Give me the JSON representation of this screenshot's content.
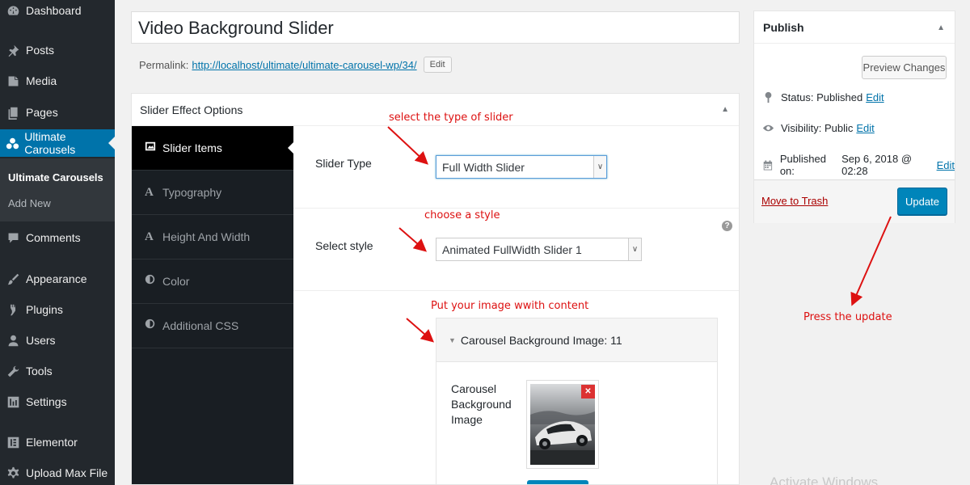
{
  "sidebar": {
    "items": [
      {
        "label": "Dashboard",
        "icon": "dashboard-icon"
      },
      {
        "label": "Posts",
        "icon": "pin-icon"
      },
      {
        "label": "Media",
        "icon": "media-icon"
      },
      {
        "label": "Pages",
        "icon": "pages-icon"
      },
      {
        "label": "Ultimate Carousels",
        "icon": "carousel-icon"
      },
      {
        "label": "Comments",
        "icon": "comment-icon"
      },
      {
        "label": "Appearance",
        "icon": "brush-icon"
      },
      {
        "label": "Plugins",
        "icon": "plugin-icon"
      },
      {
        "label": "Users",
        "icon": "users-icon"
      },
      {
        "label": "Tools",
        "icon": "wrench-icon"
      },
      {
        "label": "Settings",
        "icon": "settings-icon"
      },
      {
        "label": "Elementor",
        "icon": "elementor-icon"
      },
      {
        "label": "Upload Max File",
        "icon": "gear-icon"
      }
    ],
    "submenu": [
      "Ultimate Carousels",
      "Add New"
    ]
  },
  "editor": {
    "title": "Video Background Slider",
    "permalink_label": "Permalink:",
    "permalink_url": "http://localhost/ultimate/ultimate-carousel-wp/34/",
    "edit_label": "Edit"
  },
  "options": {
    "heading": "Slider Effect Options",
    "tabs": [
      {
        "label": "Slider Items",
        "icon": "image-icon"
      },
      {
        "label": "Typography",
        "icon": "A"
      },
      {
        "label": "Height And Width",
        "icon": "A"
      },
      {
        "label": "Color",
        "icon": "contrast-icon"
      },
      {
        "label": "Additional CSS",
        "icon": "contrast-icon"
      }
    ],
    "slider_type_label": "Slider Type",
    "slider_type_value": "Full Width Slider",
    "style_label": "Select style",
    "style_value": "Animated FullWidth Slider 1",
    "help": "?",
    "carousel_heading": "Carousel Background Image: 11",
    "carousel_field_label": "Carousel Background Image"
  },
  "publish": {
    "heading": "Publish",
    "preview_label": "Preview Changes",
    "status_label": "Status:",
    "status_value": "Published",
    "visibility_label": "Visibility:",
    "visibility_value": "Public",
    "published_label": "Published on:",
    "published_value": "Sep 6, 2018 @ 02:28",
    "edit_label": "Edit",
    "trash_label": "Move to Trash",
    "update_label": "Update"
  },
  "annotations": {
    "slider_type": "select the type of slider",
    "style": "choose a style",
    "image": "Put your image wwith content",
    "update": "Press the update"
  },
  "watermark": "Activate Windows",
  "colors": {
    "accent": "#0073aa",
    "button": "#0085ba",
    "annotation": "#dd1111",
    "sidebar": "#23282d"
  }
}
